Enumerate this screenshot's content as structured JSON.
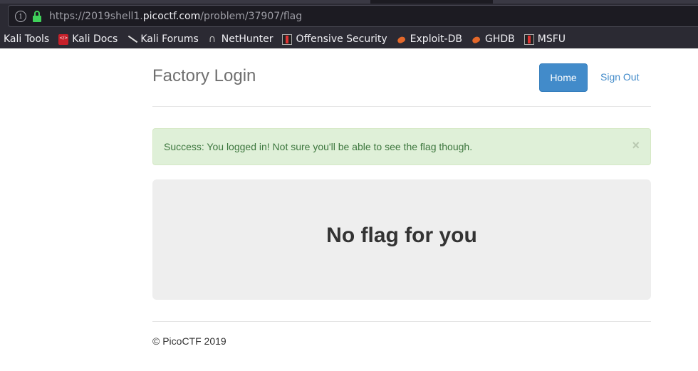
{
  "browser": {
    "url_prefix": "https://2019shell1.",
    "url_domain": "picoctf.com",
    "url_path": "/problem/37907/flag",
    "bookmarks": [
      {
        "label": "Kali Tools",
        "icon": "none"
      },
      {
        "label": "Kali Docs",
        "icon": "kali-docs-icon"
      },
      {
        "label": "Kali Forums",
        "icon": "kali-forums-icon"
      },
      {
        "label": "NetHunter",
        "icon": "nethunter-icon"
      },
      {
        "label": "Offensive Security",
        "icon": "offensive-security-icon"
      },
      {
        "label": "Exploit-DB",
        "icon": "exploit-db-icon"
      },
      {
        "label": "GHDB",
        "icon": "ghdb-icon"
      },
      {
        "label": "MSFU",
        "icon": "msfu-icon"
      }
    ]
  },
  "header": {
    "title": "Factory Login",
    "nav": {
      "home": "Home",
      "sign_out": "Sign Out"
    }
  },
  "alert": {
    "message": "Success: You logged in! Not sure you'll be able to see the flag though.",
    "close": "×"
  },
  "jumbotron": {
    "heading": "No flag for you"
  },
  "footer": {
    "text": "© PicoCTF 2019"
  },
  "colors": {
    "primary": "#428bca",
    "success_bg": "#dff0d8",
    "success_text": "#3c763d",
    "jumbotron_bg": "#eeeeee"
  }
}
